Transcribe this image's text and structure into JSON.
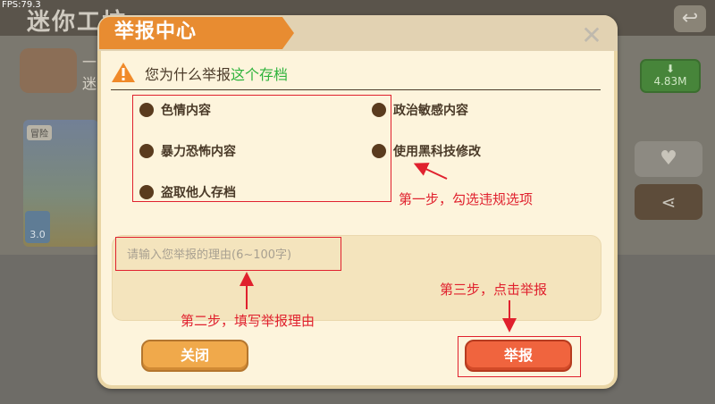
{
  "fps": "FPS:79.3",
  "background": {
    "title": "迷你工坊",
    "back_icon": "back-arrow-icon",
    "user_line1": "一",
    "user_line2": "迷",
    "download_size": "4.83M",
    "tag": "冒险",
    "like_count": "3.0"
  },
  "dialog": {
    "title": "举报中心",
    "question_prefix": "您为什么举报",
    "question_link": "这个存档",
    "options": [
      {
        "label": "色情内容"
      },
      {
        "label": "政治敏感内容"
      },
      {
        "label": "暴力恐怖内容"
      },
      {
        "label": "使用黑科技修改"
      },
      {
        "label": "盗取他人存档"
      }
    ],
    "reason_placeholder": "请输入您举报的理由(6~100字)",
    "close_label": "关闭",
    "report_label": "举报"
  },
  "annotations": {
    "step1": "第一步，勾选违规选项",
    "step2": "第二步，填写举报理由",
    "step3": "第三步，点击举报"
  },
  "colors": {
    "accent_orange": "#e88c31",
    "link_green": "#2fb33c",
    "report_red": "#f0643e",
    "annotation_red": "#e0212e"
  }
}
